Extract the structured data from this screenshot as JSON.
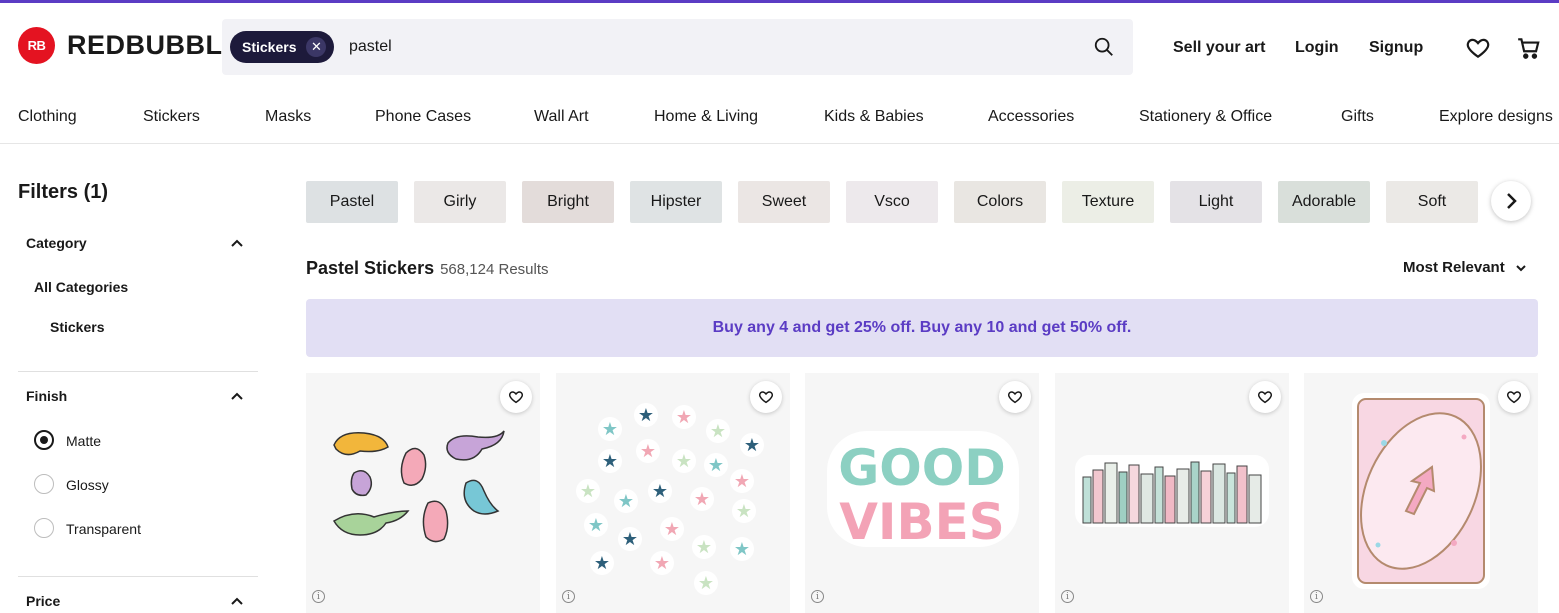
{
  "brand": {
    "logo_mark": "RB",
    "name": "REDBUBBLE",
    "accent": "#e41321",
    "brand_purple": "#5b3cc4"
  },
  "search": {
    "chip_label": "Stickers",
    "query": "pastel"
  },
  "header_links": {
    "sell": "Sell your art",
    "login": "Login",
    "signup": "Signup"
  },
  "header_icons": [
    "heart-icon",
    "cart-icon"
  ],
  "nav": [
    "Clothing",
    "Stickers",
    "Masks",
    "Phone Cases",
    "Wall Art",
    "Home & Living",
    "Kids & Babies",
    "Accessories",
    "Stationery & Office",
    "Gifts",
    "Explore designs"
  ],
  "filters": {
    "title": "Filters (1)",
    "category": {
      "label": "Category",
      "all": "All Categories",
      "selected": "Stickers"
    },
    "finish": {
      "label": "Finish",
      "options": [
        "Matte",
        "Glossy",
        "Transparent"
      ],
      "selected": "Matte"
    },
    "price": {
      "label": "Price"
    }
  },
  "tags": [
    {
      "label": "Pastel",
      "color": "#dde1e3"
    },
    {
      "label": "Girly",
      "color": "#ebe8e7"
    },
    {
      "label": "Bright",
      "color": "#e3dcda"
    },
    {
      "label": "Hipster",
      "color": "#dfe3e4"
    },
    {
      "label": "Sweet",
      "color": "#ebe6e4"
    },
    {
      "label": "Vsco",
      "color": "#ede9ec"
    },
    {
      "label": "Colors",
      "color": "#e9e6e2"
    },
    {
      "label": "Texture",
      "color": "#eceee6"
    },
    {
      "label": "Light",
      "color": "#e4e2e6"
    },
    {
      "label": "Adorable",
      "color": "#d9dfda"
    },
    {
      "label": "Soft",
      "color": "#ebe9e6"
    }
  ],
  "results": {
    "title": "Pastel Stickers",
    "count": "568,124 Results",
    "sort": "Most Relevant"
  },
  "promo": "Buy any 4 and get 25% off.  Buy any 10 and get 50% off.",
  "products": [
    {
      "name": "dinosaur-stickers"
    },
    {
      "name": "star-stickers"
    },
    {
      "name": "good-vibes-sticker",
      "text_line1": "GOOD",
      "text_line2": "VIBES"
    },
    {
      "name": "books-sticker"
    },
    {
      "name": "reverse-card-sticker"
    }
  ]
}
